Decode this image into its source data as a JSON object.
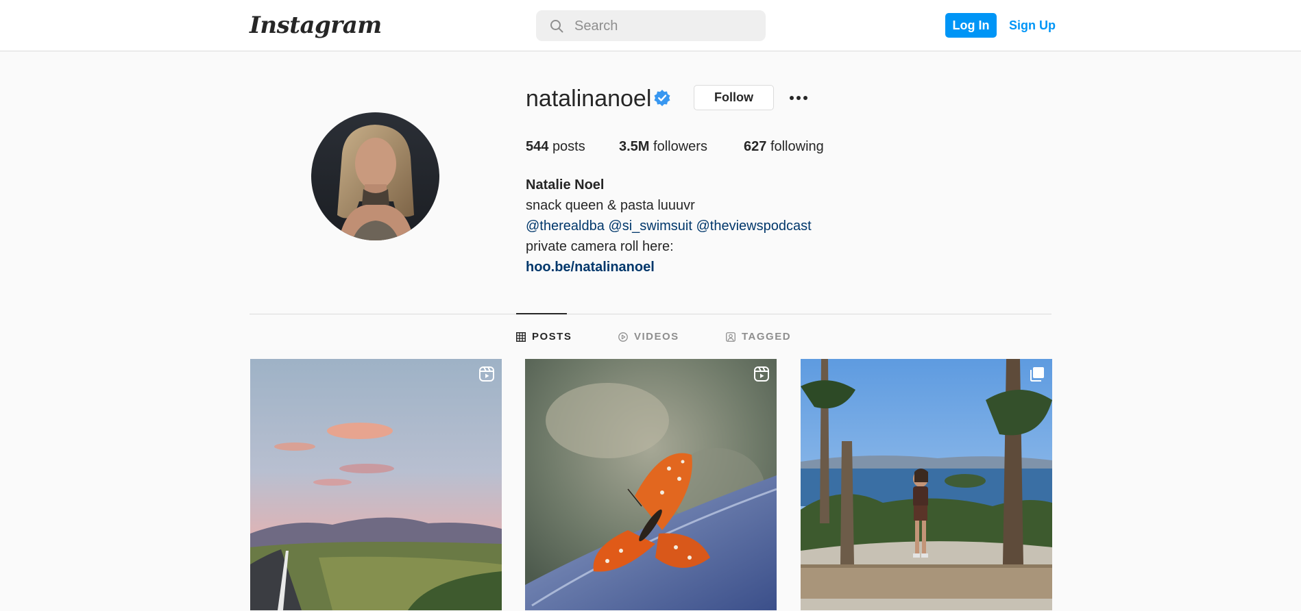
{
  "header": {
    "logo_text": "Instagram",
    "search_placeholder": "Search",
    "login_label": "Log In",
    "signup_label": "Sign Up",
    "accent_color": "#0095f6"
  },
  "profile": {
    "username": "natalinanoel",
    "verified": true,
    "follow_label": "Follow",
    "stats": {
      "posts_count": "544",
      "posts_label": "posts",
      "followers_count": "3.5M",
      "followers_label": "followers",
      "following_count": "627",
      "following_label": "following"
    },
    "bio": {
      "full_name": "Natalie Noel",
      "line1": "snack queen & pasta luuuvr",
      "mentions": [
        "@therealdba",
        "@si_swimsuit",
        "@theviewspodcast"
      ],
      "line3": "private camera roll here:",
      "link": "hoo.be/natalinanoel"
    }
  },
  "tabs": [
    {
      "label": "POSTS",
      "icon": "grid-icon",
      "active": true
    },
    {
      "label": "VIDEOS",
      "icon": "play-circle-icon",
      "active": false
    },
    {
      "label": "TAGGED",
      "icon": "tagged-user-icon",
      "active": false
    }
  ],
  "posts": [
    {
      "subject": "sunset-road",
      "badge": "reel-icon"
    },
    {
      "subject": "orange-butterfly",
      "badge": "reel-icon"
    },
    {
      "subject": "lake-hike",
      "badge": "multi-photo-icon"
    }
  ]
}
